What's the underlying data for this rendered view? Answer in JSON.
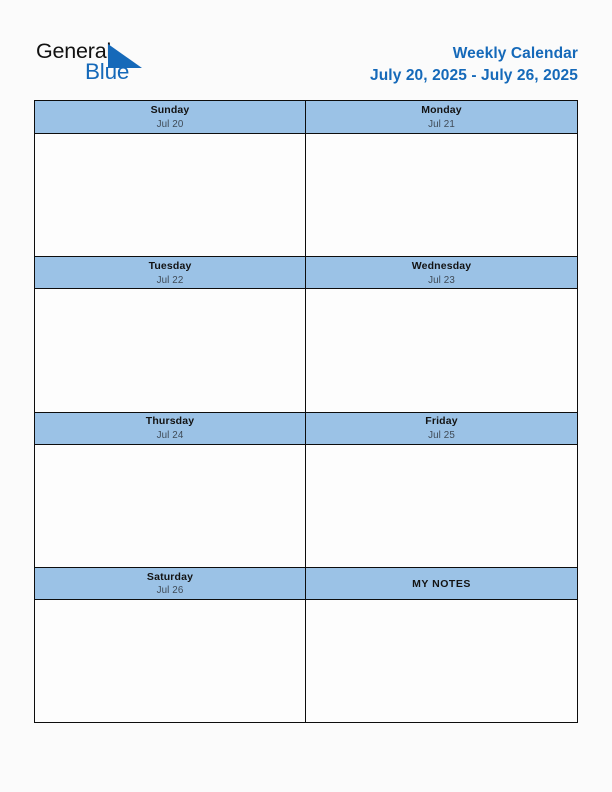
{
  "brand": {
    "word_one": "General",
    "word_two": "Blue",
    "triangle_icon": "triangle-logo-icon",
    "blue_hex": "#1569b9",
    "dark_hex": "#111111"
  },
  "header": {
    "title": "Weekly Calendar",
    "date_range": "July 20, 2025 - July 26, 2025",
    "title_color_hex": "#1569b9"
  },
  "calendar": {
    "header_bg_hex": "#9bc2e6",
    "border_hex": "#0d0d0d",
    "cell_bg_hex": "#fdfdfd",
    "bands": [
      {
        "left": {
          "day": "Sunday",
          "date": "Jul 20",
          "note": ""
        },
        "right": {
          "day": "Monday",
          "date": "Jul 21",
          "note": ""
        }
      },
      {
        "left": {
          "day": "Tuesday",
          "date": "Jul 22",
          "note": ""
        },
        "right": {
          "day": "Wednesday",
          "date": "Jul 23",
          "note": ""
        }
      },
      {
        "left": {
          "day": "Thursday",
          "date": "Jul 24",
          "note": ""
        },
        "right": {
          "day": "Friday",
          "date": "Jul 25",
          "note": ""
        }
      },
      {
        "left": {
          "day": "Saturday",
          "date": "Jul 26",
          "note": ""
        },
        "right": {
          "day": "MY NOTES",
          "date": "",
          "note": ""
        }
      }
    ]
  }
}
